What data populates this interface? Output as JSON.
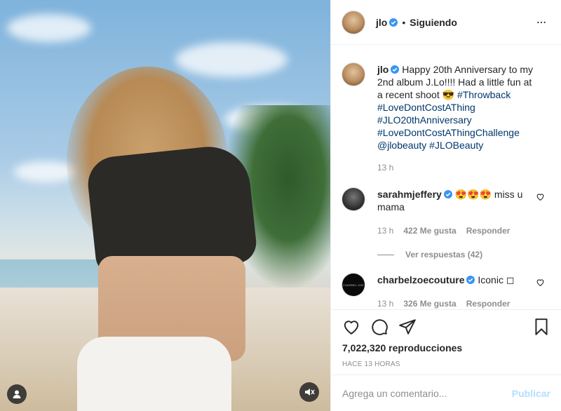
{
  "post": {
    "author": "jlo",
    "follow_separator": "•",
    "follow_status": "Siguiendo",
    "caption_text": "Happy 20th Anniversary to my 2nd album J.Lo!!!! Had a little fun at a recent shoot 😎",
    "caption_tags": [
      "#Throwback",
      "#LoveDontCostAThing",
      "#JLO20thAnniversary",
      "#LoveDontCostAThingChallenge",
      "@jlobeauty",
      "#JLOBeauty"
    ],
    "caption_time": "13 h",
    "views": "7,022,320 reproducciones",
    "posted_ago": "HACE 13 HORAS"
  },
  "comments": [
    {
      "user": "sarahmjeffery",
      "text": "😍😍😍 miss u mama",
      "time": "13 h",
      "likes": "422 Me gusta",
      "reply": "Responder",
      "view_replies": "Ver respuestas (42)"
    },
    {
      "user": "charbelzoecouture",
      "text": "Iconic ◻",
      "time": "13 h",
      "likes": "326 Me gusta",
      "reply": "Responder",
      "avatar_text": "CHARBEL ZOE"
    }
  ],
  "composer": {
    "placeholder": "Agrega un comentario...",
    "publish_label": "Publicar"
  },
  "colors": {
    "verified": "#3897f0",
    "link": "#00376b",
    "secondary_text": "#8e8e8e",
    "publish_disabled": "#b2dffc"
  },
  "icons": [
    "more-options-icon",
    "verified-badge-icon",
    "heart-icon",
    "like-icon",
    "comment-icon",
    "share-icon",
    "bookmark-icon",
    "user-tag-icon",
    "mute-icon"
  ]
}
